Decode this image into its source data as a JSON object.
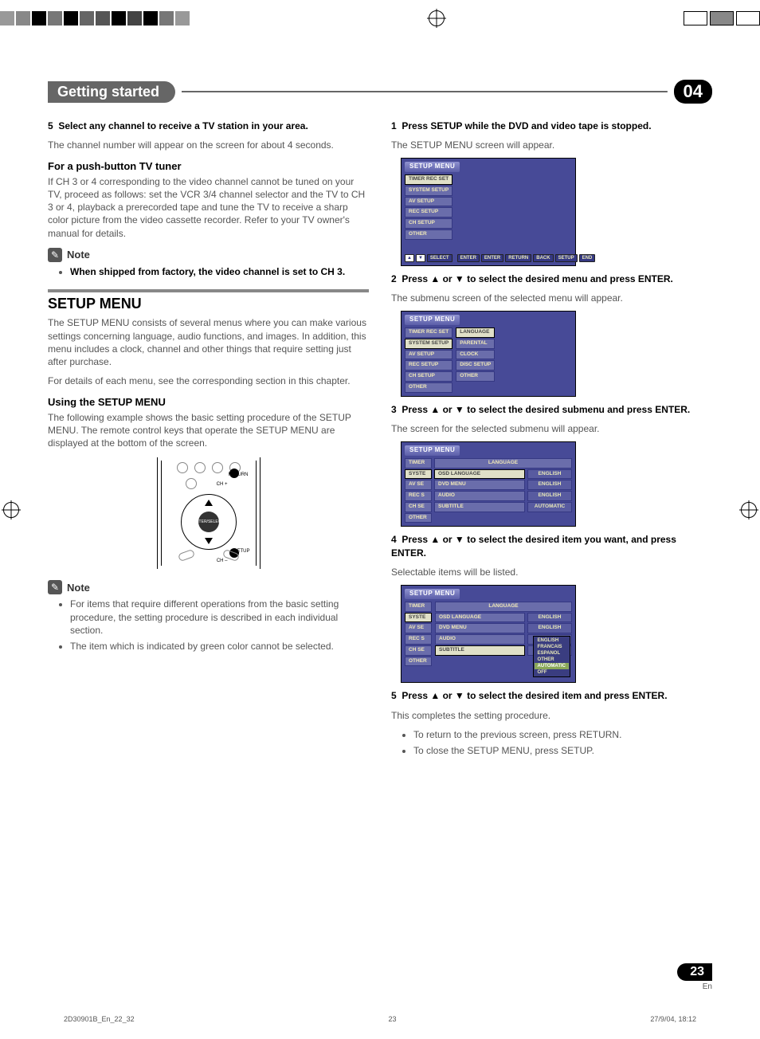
{
  "header": {
    "tab": "Getting started",
    "chapter": "04"
  },
  "left": {
    "step5": {
      "num": "5",
      "title": "Select any channel to receive a TV station in your area.",
      "body": "The channel number will appear on the screen for about 4 seconds."
    },
    "pushTuner": {
      "title": "For a push-button TV tuner",
      "body": "If CH 3 or 4 corresponding to the video channel cannot be tuned on your TV, proceed as follows: set the VCR 3/4 channel selector and the TV to CH 3 or 4, playback a prerecorded tape and tune the TV to receive a sharp color picture from the video cassette recorder. Refer to your TV owner's manual for details."
    },
    "note1": {
      "label": "Note",
      "bullet": "When shipped from factory, the video channel is set to CH 3."
    },
    "setupMenu": {
      "title": "SETUP MENU",
      "p1": "The SETUP MENU consists of several menus where you can make various settings concerning language, audio functions, and images. In addition, this menu includes a clock, channel and other things that require setting just after purchase.",
      "p2": "For details of each menu, see the corresponding section in this chapter."
    },
    "using": {
      "title": "Using the SETUP MENU",
      "body": "The following example shows the basic setting procedure of the SETUP MENU. The remote control keys that operate the SETUP MENU are displayed at the bottom of the screen."
    },
    "remote": {
      "enter": "ENTER/SELECT",
      "return": "RETURN",
      "setup": "SETUP",
      "chp": "CH +",
      "chm": "CH –"
    },
    "note2": {
      "label": "Note",
      "b1": "For items that require different operations from the basic setting procedure, the setting procedure is described in each individual section.",
      "b2": "The item which is indicated by green color cannot be selected."
    }
  },
  "right": {
    "s1": {
      "num": "1",
      "title": "Press SETUP while the DVD and video tape is stopped.",
      "body": "The SETUP MENU screen will appear."
    },
    "s2": {
      "num": "2",
      "title": "Press ▲ or ▼ to select the desired menu and press ENTER.",
      "body": "The submenu screen of the selected menu will appear."
    },
    "s3": {
      "num": "3",
      "title": "Press ▲ or ▼ to select the desired submenu and press ENTER.",
      "body": "The screen for the selected submenu will appear."
    },
    "s4": {
      "num": "4",
      "title": "Press ▲ or ▼ to select the desired item you want, and press ENTER.",
      "body": "Selectable items will be listed."
    },
    "s5": {
      "num": "5",
      "title": "Press ▲ or ▼ to select the desired item and press ENTER.",
      "body": "This completes the setting procedure.",
      "b1": "To return to the previous screen, press RETURN.",
      "b2": "To close the SETUP MENU, press SETUP."
    }
  },
  "osd": {
    "title": "SETUP MENU",
    "leftItems": [
      "TIMER REC SET",
      "SYSTEM SETUP",
      "AV SETUP",
      "REC SETUP",
      "CH SETUP",
      "OTHER"
    ],
    "sub2": [
      "LANGUAGE",
      "PARENTAL",
      "CLOCK",
      "DISC SETUP",
      "OTHER"
    ],
    "tabLeft": [
      "TIMER",
      "SYSTE",
      "AV SE",
      "REC S",
      "CH SE",
      "OTHER"
    ],
    "langHeader": "LANGUAGE",
    "langRows": [
      "OSD LANGUAGE",
      "DVD MENU",
      "AUDIO",
      "SUBTITLE"
    ],
    "langVals": [
      "ENGLISH",
      "ENGLISH",
      "ENGLISH",
      "AUTOMATIC"
    ],
    "popup": [
      "ENGLISH",
      "FRANCAIS",
      "ESPANOL",
      "OTHER",
      "AUTOMATIC",
      "OFF"
    ],
    "hints": {
      "select": "SELECT",
      "enter": "ENTER",
      "return": "RETURN",
      "back": "BACK",
      "setup": "SETUP",
      "end": "END"
    }
  },
  "footer": {
    "page": "23",
    "lang": "En",
    "file": "2D30901B_En_22_32",
    "printPage": "23",
    "timestamp": "27/9/04, 18:12"
  }
}
